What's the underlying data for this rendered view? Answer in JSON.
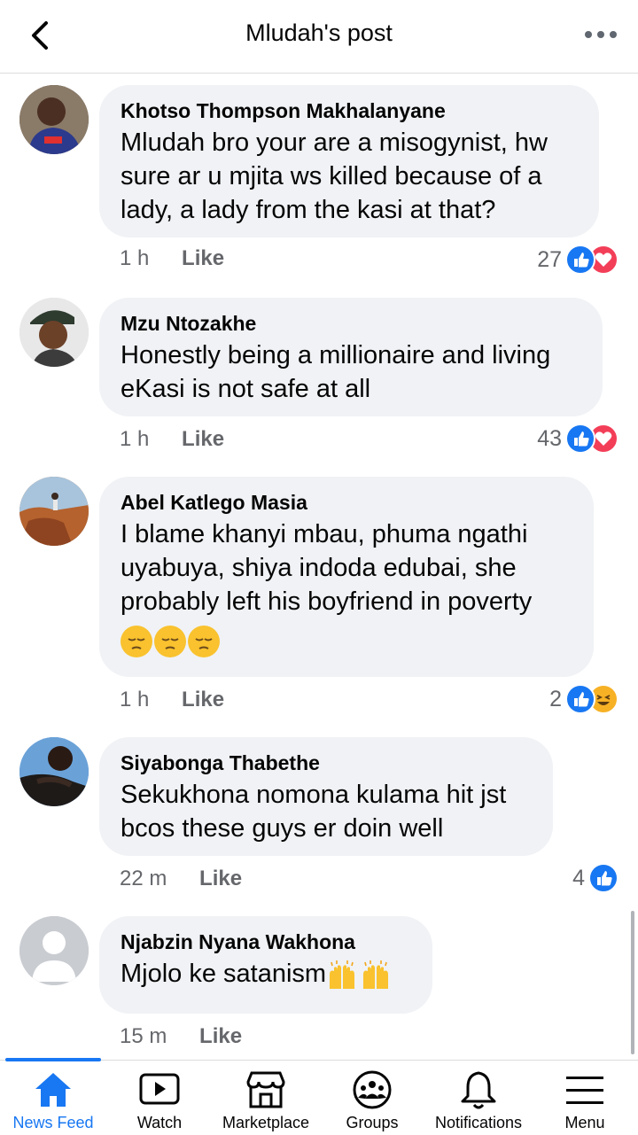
{
  "header": {
    "title": "Mludah's post"
  },
  "comments": [
    {
      "author": "Khotso Thompson Makhalanyane",
      "text": "Mludah bro your are a misogynist, hw sure ar u mjita ws killed because of a lady, a lady from the kasi at that?",
      "time": "1 h",
      "like_label": "Like",
      "reaction_count": "27",
      "reactions": [
        "like",
        "love"
      ]
    },
    {
      "author": "Mzu Ntozakhe",
      "text": "Honestly being a millionaire and living eKasi is not safe at all",
      "time": "1 h",
      "like_label": "Like",
      "reaction_count": "43",
      "reactions": [
        "like",
        "love"
      ]
    },
    {
      "author": "Abel Katlego Masia",
      "text": "I blame khanyi mbau, phuma ngathi uyabuya, shiya indoda edubai, she probably left his boyfriend in poverty",
      "emojis": [
        "pensive-face",
        "pensive-face",
        "pensive-face"
      ],
      "time": "1 h",
      "like_label": "Like",
      "reaction_count": "2",
      "reactions": [
        "like",
        "haha"
      ]
    },
    {
      "author": "Siyabonga Thabethe",
      "text": "Sekukhona nomona kulama hit jst bcos these guys er doin well",
      "time": "22 m",
      "like_label": "Like",
      "reaction_count": "4",
      "reactions": [
        "like"
      ]
    },
    {
      "author": "Njabzin Nyana Wakhona",
      "text": "Mjolo ke satanism",
      "emojis": [
        "raising-hands",
        "raising-hands"
      ],
      "time": "15 m",
      "like_label": "Like",
      "reaction_count": "",
      "reactions": []
    }
  ],
  "tabs": [
    {
      "label": "News Feed",
      "icon": "home-icon",
      "active": true
    },
    {
      "label": "Watch",
      "icon": "video-icon",
      "active": false
    },
    {
      "label": "Marketplace",
      "icon": "shop-icon",
      "active": false
    },
    {
      "label": "Groups",
      "icon": "groups-icon",
      "active": false
    },
    {
      "label": "Notifications",
      "icon": "bell-icon",
      "active": false
    },
    {
      "label": "Menu",
      "icon": "hamburger-icon",
      "active": false
    }
  ],
  "colors": {
    "accent": "#1877f2",
    "bubble": "#f0f2f5",
    "meta": "#65676b",
    "love": "#f33e58",
    "haha": "#f7b125"
  }
}
